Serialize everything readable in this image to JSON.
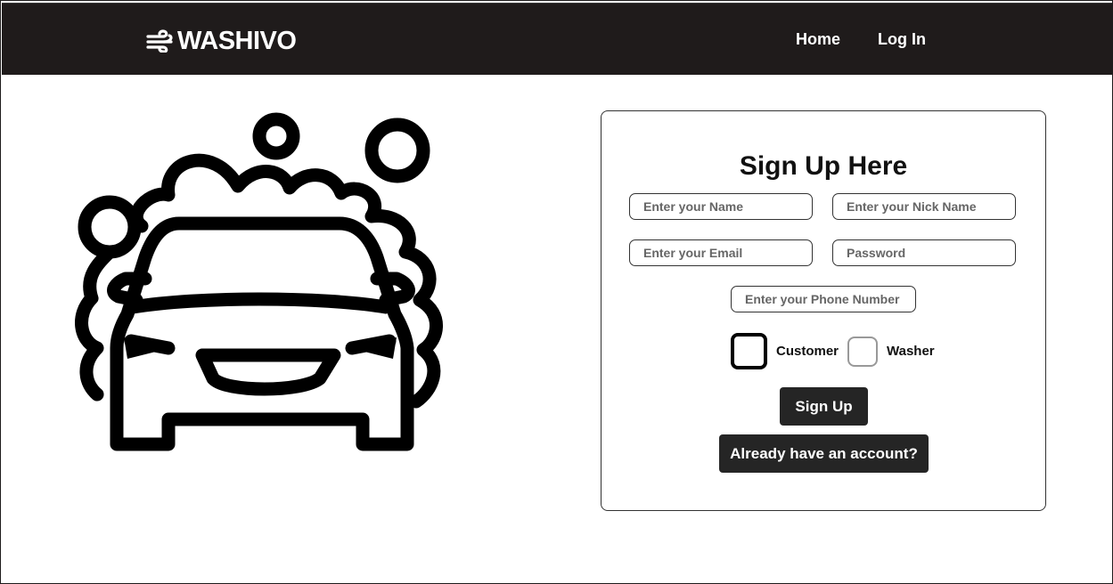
{
  "navbar": {
    "brand": "WASHIVO",
    "brand_icon": "wind-icon",
    "links": [
      {
        "label": "Home"
      },
      {
        "label": "Log In"
      }
    ]
  },
  "illustration": {
    "icon": "car-wash-icon"
  },
  "form": {
    "title": "Sign Up Here",
    "name_placeholder": "Enter your Name",
    "nick_placeholder": "Enter your Nick Name",
    "email_placeholder": "Enter your Email",
    "password_placeholder": "Password",
    "phone_placeholder": "Enter your Phone Number",
    "roles": [
      {
        "label": "Customer",
        "checked": false
      },
      {
        "label": "Washer",
        "checked": false
      }
    ],
    "signup_label": "Sign Up",
    "login_label": "Already have an account?"
  },
  "colors": {
    "navbar_bg": "#1f1b1b",
    "button_bg": "#252525",
    "text": "#111111"
  }
}
